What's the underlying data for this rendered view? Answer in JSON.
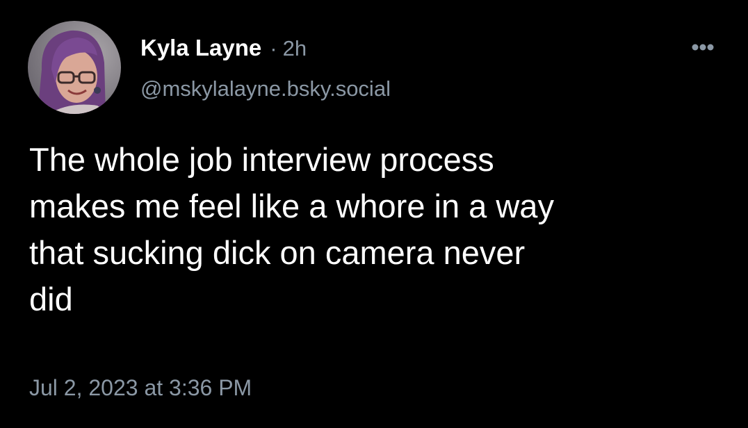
{
  "post": {
    "author": {
      "display_name": "Kyla Layne",
      "handle": "@mskylalayne.bsky.social",
      "avatar_icon": "user-avatar-photo"
    },
    "separator": "·",
    "time_ago": "2h",
    "more_icon": "more-horizontal-icon",
    "text": "The whole job interview process\nmakes me feel like a whore in a way\nthat sucking dick on camera never\ndid",
    "timestamp": "Jul 2, 2023 at 3:36 PM"
  },
  "colors": {
    "background": "#000000",
    "primary_text": "#ffffff",
    "secondary_text": "#8b98a5"
  }
}
